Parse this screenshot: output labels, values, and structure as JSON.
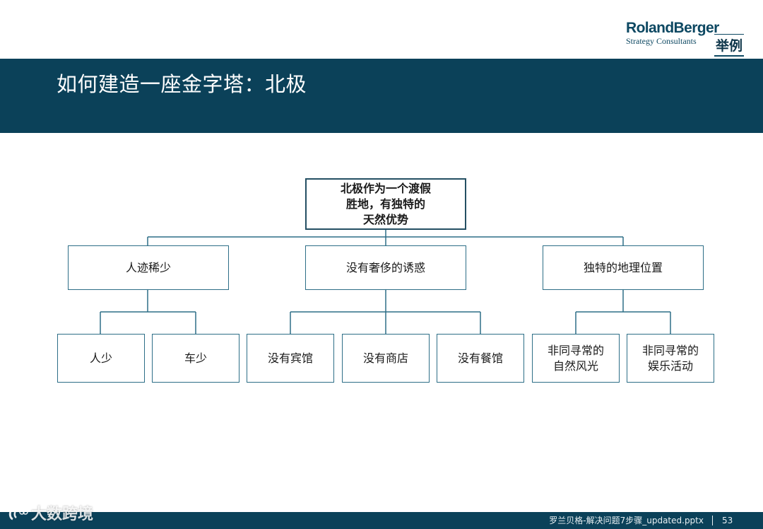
{
  "brand": {
    "name": "RolandBerger",
    "subtitle": "Strategy Consultants"
  },
  "tag": "举例",
  "title": "如何建造一座金字塔：北极",
  "tree": {
    "root": "北极作为一个渡假\n胜地，有独特的\n天然优势",
    "level1": [
      "人迹稀少",
      "没有奢侈的诱惑",
      "独特的地理位置"
    ],
    "level2": [
      [
        "人少",
        "车少"
      ],
      [
        "没有宾馆",
        "没有商店",
        "没有餐馆"
      ],
      [
        "非同寻常的\n自然风光",
        "非同寻常的\n娱乐活动"
      ]
    ]
  },
  "footer": {
    "file": "罗兰贝格-解决问题7步骤_updated.pptx",
    "page": "53"
  },
  "watermark": "大数跨境",
  "colors": {
    "band": "#0b4159",
    "border": "#2d6e87",
    "brand": "#0d4862"
  }
}
